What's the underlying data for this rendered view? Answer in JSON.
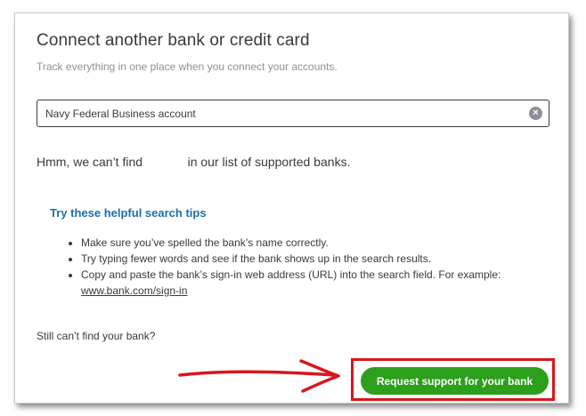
{
  "dialog": {
    "title": "Connect another bank or credit card",
    "subtitle": "Track everything in one place when you connect your accounts."
  },
  "search": {
    "value": "Navy Federal Business account",
    "clear_icon": "clear-icon"
  },
  "result": {
    "not_found_text": "Hmm, we can’t find             in our list of supported banks."
  },
  "tips": {
    "heading": "Try these helpful search tips",
    "items": [
      "Make sure you’ve spelled the bank’s name correctly.",
      "Try typing fewer words and see if the bank shows up in the search results.",
      "Copy and paste the bank’s sign-in web address (URL) into the search field. For example:"
    ],
    "example_link": "www.bank.com/sign-in"
  },
  "footer": {
    "still_text": "Still can’t find your bank?",
    "request_button": "Request support for your bank"
  },
  "colors": {
    "primary_green": "#2ca01c",
    "link_blue": "#1b6fa8",
    "annotation_red": "#d9161c",
    "text": "#393a3d"
  }
}
